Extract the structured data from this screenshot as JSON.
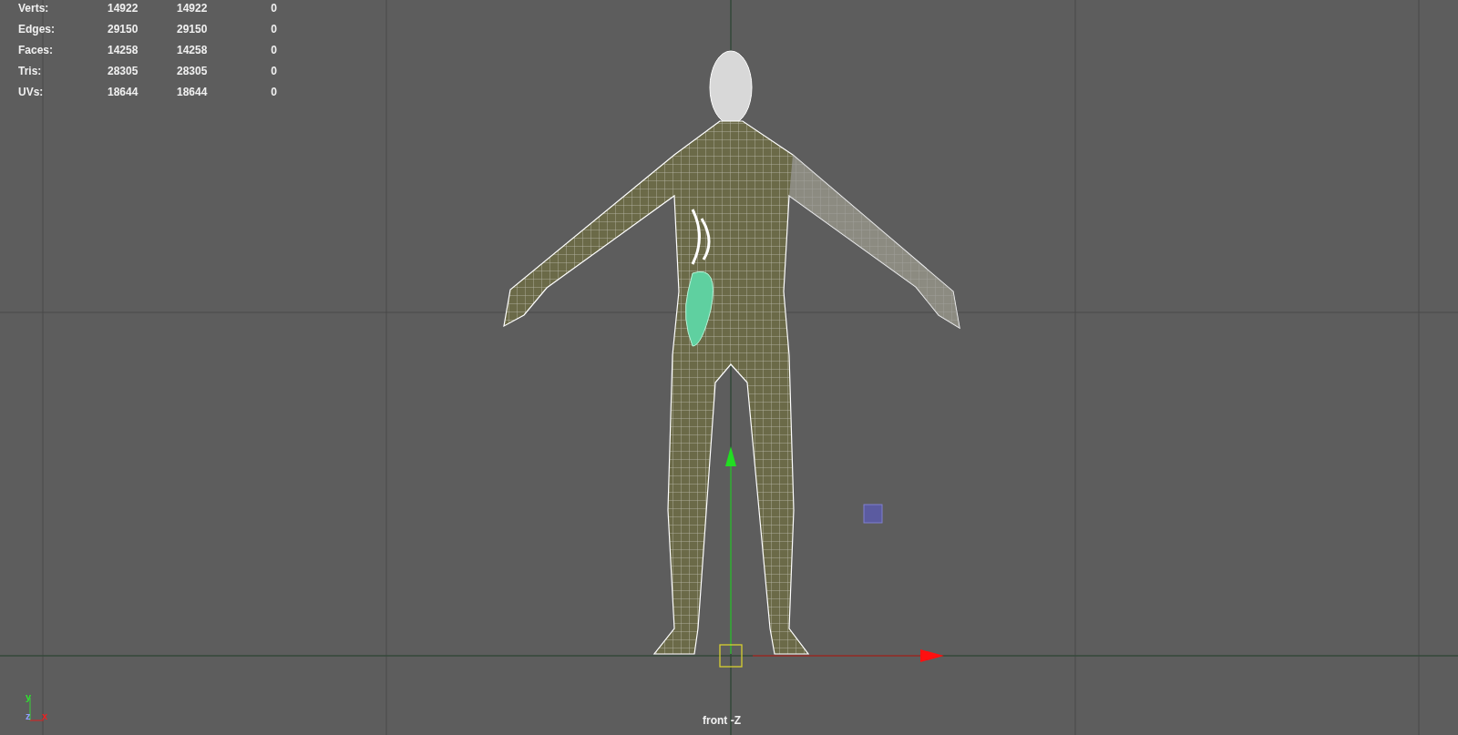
{
  "stats": [
    {
      "label": "Verts:",
      "column_2": "14922",
      "column_3": "14922",
      "column_4": "0"
    },
    {
      "label": "Edges:",
      "column_2": "29150",
      "column_3": "29150",
      "column_4": "0"
    },
    {
      "label": "Faces:",
      "column_2": "14258",
      "column_3": "14258",
      "column_4": "0"
    },
    {
      "label": "Tris:",
      "column_2": "28305",
      "column_3": "28305",
      "column_4": "0"
    },
    {
      "label": "UVs:",
      "column_2": "18644",
      "column_3": "18644",
      "column_4": "0"
    }
  ],
  "camera_label": "front -Z",
  "axis_indicator": {
    "y": "y",
    "z": "z",
    "x": "x"
  }
}
